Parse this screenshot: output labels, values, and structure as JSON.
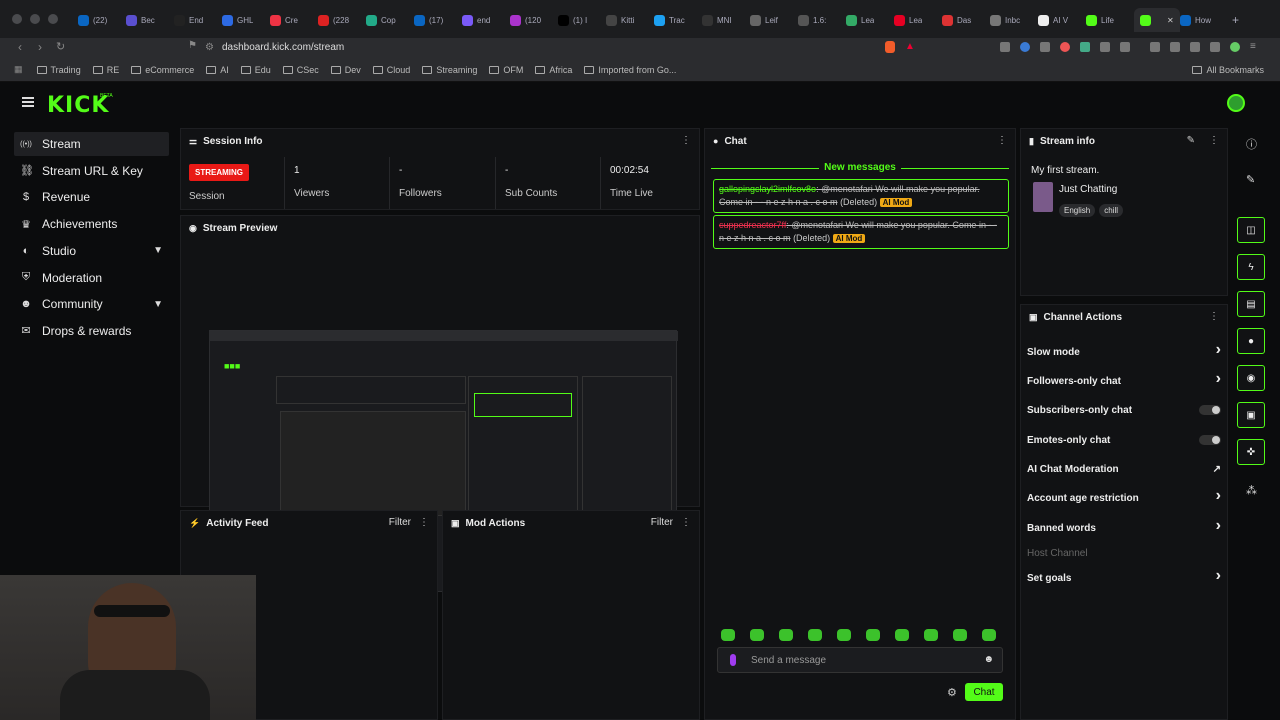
{
  "browser": {
    "tabs": [
      "(22)",
      "Bec",
      "End",
      "GHL",
      "Cre",
      "(228",
      "Cop",
      "(17)",
      "end",
      "(120",
      "(1) I",
      "Kitti",
      "Trac",
      "MNI",
      "Leif",
      "1.6:",
      "Lea",
      "Lea",
      "Das",
      "Inbc",
      "AI V",
      "Life",
      "",
      "How"
    ],
    "url": "dashboard.kick.com/stream",
    "bookmarks": [
      "Trading",
      "RE",
      "eCommerce",
      "AI",
      "Edu",
      "CSec",
      "Dev",
      "Cloud",
      "Streaming",
      "OFM",
      "Africa",
      "Imported from Go..."
    ],
    "all_bookmarks": "All Bookmarks"
  },
  "brand": {
    "logo": "KICK",
    "beta": "BETA",
    "accent": "#53fc18"
  },
  "sidebar": {
    "items": [
      {
        "label": "Stream",
        "icon": "broadcast-icon"
      },
      {
        "label": "Stream URL & Key",
        "icon": "link-icon"
      },
      {
        "label": "Revenue",
        "icon": "dollar-icon"
      },
      {
        "label": "Achievements",
        "icon": "trophy-icon"
      },
      {
        "label": "Studio",
        "icon": "palette-icon"
      },
      {
        "label": "Moderation",
        "icon": "shield-icon"
      },
      {
        "label": "Community",
        "icon": "people-icon"
      },
      {
        "label": "Drops & rewards",
        "icon": "gift-icon"
      }
    ]
  },
  "session": {
    "title": "Session Info",
    "status": "STREAMING",
    "status_label": "Session",
    "viewers_value": "1",
    "viewers_label": "Viewers",
    "followers_value": "-",
    "followers_label": "Followers",
    "subs_value": "-",
    "subs_label": "Sub Counts",
    "time_value": "00:02:54",
    "time_label": "Time Live"
  },
  "preview": {
    "title": "Stream Preview"
  },
  "activity": {
    "title": "Activity Feed",
    "filter": "Filter"
  },
  "mod": {
    "title": "Mod Actions",
    "filter": "Filter"
  },
  "chat": {
    "title": "Chat",
    "new_messages": "New messages",
    "messages": [
      {
        "user": "gallopingclayl2imlfcov8o",
        "text": ": @menotafari We will make you popular. Come in - - n e z h n a . c o m",
        "deleted": "(Deleted)",
        "badge": "AI Mod"
      },
      {
        "user": "cuppedreactor7ff",
        "text": ": @menotafari We will make you popular. Come in - - n e z h n a . c o m",
        "deleted": "(Deleted)",
        "badge": "AI Mod"
      }
    ],
    "placeholder": "Send a message",
    "send": "Chat"
  },
  "stream_info": {
    "title": "Stream info",
    "stream_title": "My first stream.",
    "category": "Just Chatting",
    "tags": [
      "English",
      "chill"
    ]
  },
  "channel_actions": {
    "title": "Channel Actions",
    "items": [
      {
        "label": "Slow mode",
        "control": "arrow"
      },
      {
        "label": "Followers-only chat",
        "control": "arrow"
      },
      {
        "label": "Subscribers-only chat",
        "control": "toggle"
      },
      {
        "label": "Emotes-only chat",
        "control": "toggle"
      },
      {
        "label": "AI Chat Moderation",
        "control": "external"
      },
      {
        "label": "Account age restriction",
        "control": "arrow"
      },
      {
        "label": "Banned words",
        "control": "arrow"
      },
      {
        "label": "Host Channel",
        "control": "none"
      },
      {
        "label": "Set goals",
        "control": "arrow"
      }
    ]
  }
}
